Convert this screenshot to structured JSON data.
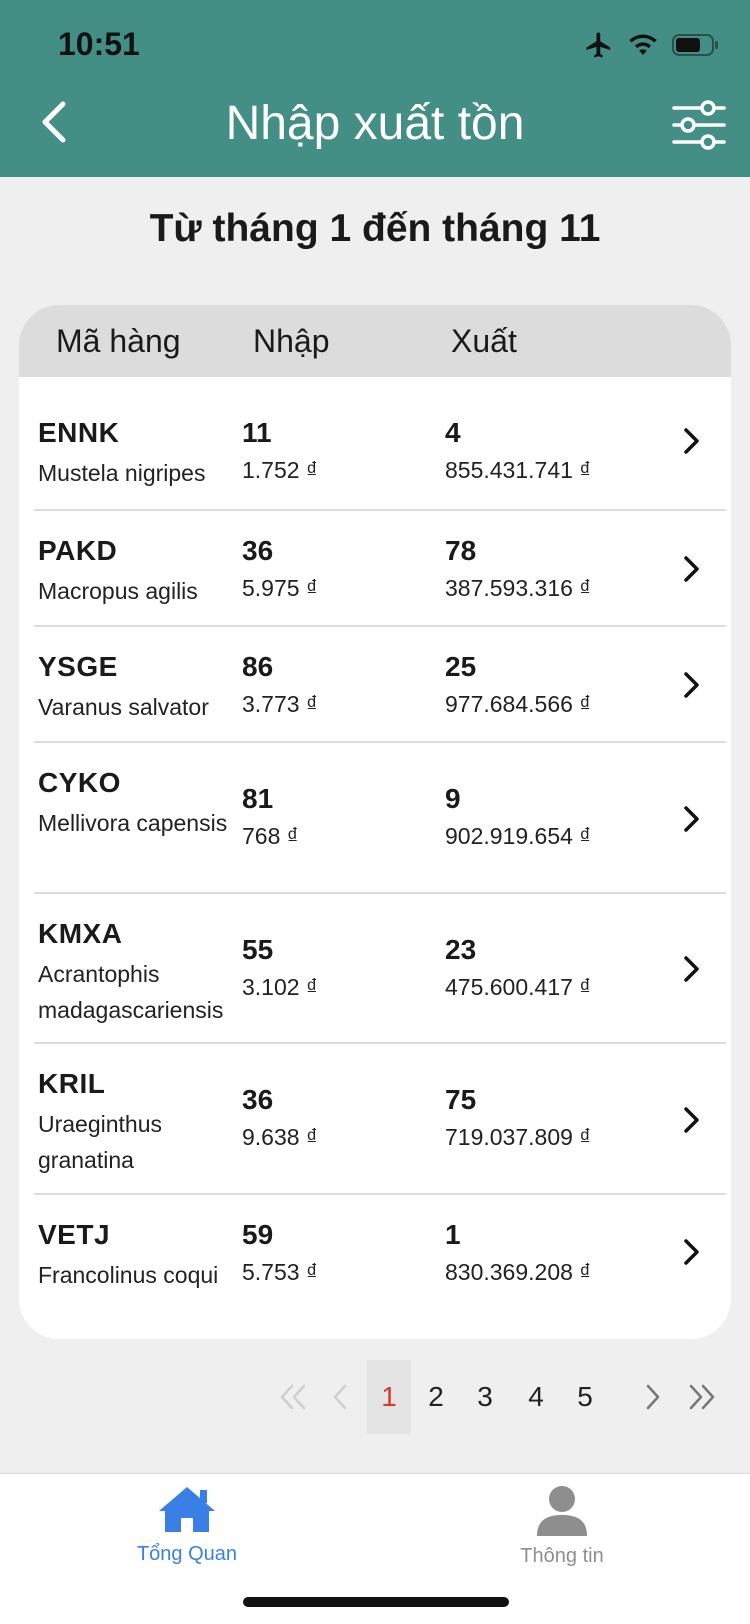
{
  "status_bar": {
    "time": "10:51"
  },
  "header": {
    "title": "Nhập xuất tồn"
  },
  "subtitle": "Từ tháng 1 đến tháng 11",
  "table": {
    "columns": {
      "code": "Mã hàng",
      "in": "Nhập",
      "out": "Xuất"
    },
    "rows": [
      {
        "code": "ENNK",
        "name": "Mustela nigripes",
        "in_qty": "11",
        "in_value": "1.752 ₫",
        "out_qty": "4",
        "out_value": "855.431.741 ₫"
      },
      {
        "code": "PAKD",
        "name": "Macropus agilis",
        "in_qty": "36",
        "in_value": "5.975 ₫",
        "out_qty": "78",
        "out_value": "387.593.316 ₫"
      },
      {
        "code": "YSGE",
        "name": "Varanus salvator",
        "in_qty": "86",
        "in_value": "3.773 ₫",
        "out_qty": "25",
        "out_value": "977.684.566 ₫"
      },
      {
        "code": "CYKO",
        "name": "Mellivora capensis",
        "in_qty": "81",
        "in_value": "768 ₫",
        "out_qty": "9",
        "out_value": "902.919.654 ₫"
      },
      {
        "code": "KMXA",
        "name": "Acrantophis madagascariensis",
        "in_qty": "55",
        "in_value": "3.102 ₫",
        "out_qty": "23",
        "out_value": "475.600.417 ₫"
      },
      {
        "code": "KRIL",
        "name": "Uraeginthus granatina",
        "in_qty": "36",
        "in_value": "9.638 ₫",
        "out_qty": "75",
        "out_value": "719.037.809 ₫"
      },
      {
        "code": "VETJ",
        "name": "Francolinus coqui",
        "in_qty": "59",
        "in_value": "5.753 ₫",
        "out_qty": "1",
        "out_value": "830.369.208 ₫"
      }
    ]
  },
  "pagination": {
    "pages": [
      "1",
      "2",
      "3",
      "4",
      "5"
    ],
    "current": "1"
  },
  "tabbar": {
    "overview_label": "Tổng Quan",
    "info_label": "Thông tin"
  },
  "colors": {
    "header": "#448f85",
    "active_tab": "#3a7fe6",
    "active_page": "#d63a2f"
  }
}
